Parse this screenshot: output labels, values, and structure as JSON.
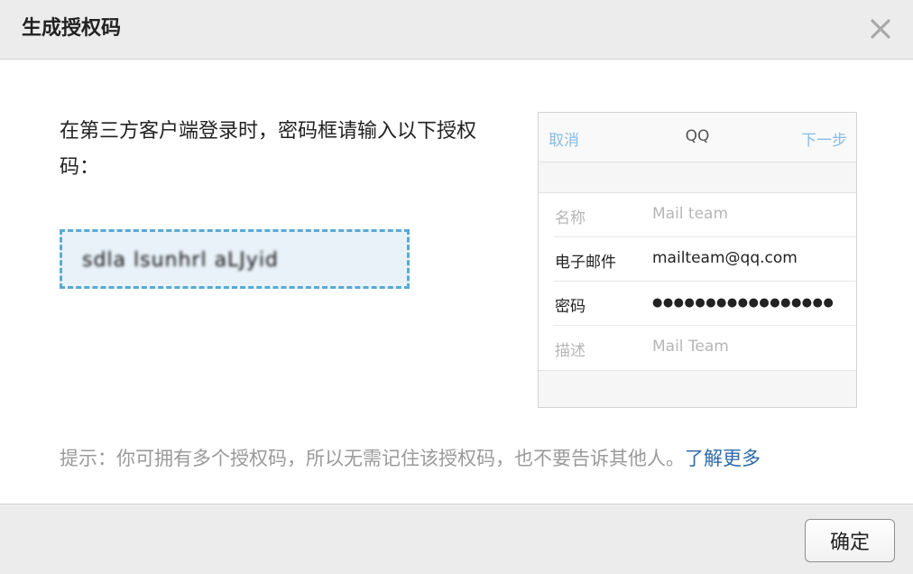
{
  "dialog": {
    "title": "生成授权码",
    "close_icon": "close-icon"
  },
  "main": {
    "instruction": "在第三方客户端登录时，密码框请输入以下授权码：",
    "auth_code": "sdla lsunhrl aLJyid"
  },
  "preview": {
    "nav": {
      "cancel": "取消",
      "title": "QQ",
      "next": "下一步"
    },
    "rows": [
      {
        "label": "名称",
        "value": "Mail team"
      },
      {
        "label": "电子邮件",
        "value": "mailteam@qq.com"
      },
      {
        "label": "密码",
        "value": "●●●●●●●●●●●●●●●●●"
      },
      {
        "label": "描述",
        "value": "Mail Team"
      }
    ]
  },
  "tip": {
    "text": "提示：你可拥有多个授权码，所以无需记住该授权码，也不要告诉其他人。",
    "link": "了解更多"
  },
  "footer": {
    "ok_label": "确定"
  },
  "colors": {
    "header_bg": "#ececec",
    "code_border": "#5aaad3",
    "code_bg": "#e8f2f8",
    "link": "#2d6aa8",
    "nav_link": "#86bde6",
    "tip_text": "#9a9a9a"
  }
}
